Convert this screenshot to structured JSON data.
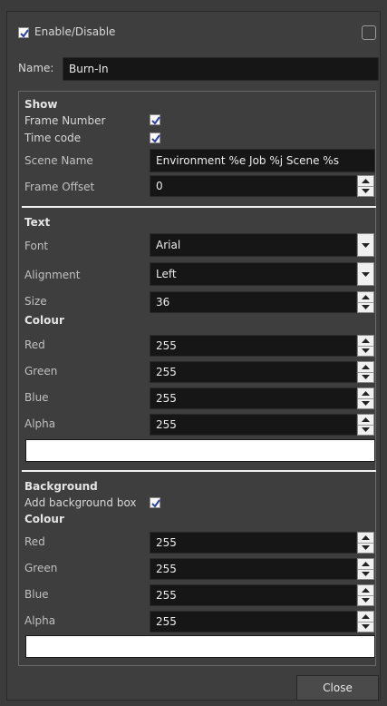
{
  "header": {
    "enable_label": "Enable/Disable",
    "name_label": "Name:",
    "name_value": "Burn-In"
  },
  "show": {
    "heading": "Show",
    "frame_number_label": "Frame Number",
    "time_code_label": "Time code",
    "scene_name_label": "Scene Name",
    "scene_name_value": "Environment %e Job %j Scene %s",
    "frame_offset_label": "Frame Offset",
    "frame_offset_value": "0"
  },
  "text": {
    "heading": "Text",
    "font_label": "Font",
    "font_value": "Arial",
    "alignment_label": "Alignment",
    "alignment_value": "Left",
    "size_label": "Size",
    "size_value": "36",
    "colour_heading": "Colour",
    "red_label": "Red",
    "red_value": "255",
    "green_label": "Green",
    "green_value": "255",
    "blue_label": "Blue",
    "blue_value": "255",
    "alpha_label": "Alpha",
    "alpha_value": "255"
  },
  "background": {
    "heading": "Background",
    "add_box_label": "Add background box",
    "colour_heading": "Colour",
    "red_label": "Red",
    "red_value": "255",
    "green_label": "Green",
    "green_value": "255",
    "blue_label": "Blue",
    "blue_value": "255",
    "alpha_label": "Alpha",
    "alpha_value": "255"
  },
  "footer": {
    "close_label": "Close"
  },
  "colors": {
    "window_bg": "#3e3e3e",
    "field_bg": "#161616",
    "checkbox_check": "#2b3f9e",
    "swatch_color": "#ffffff"
  },
  "icons": {
    "checkbox": "check-icon",
    "spin_up": "arrow-up-icon",
    "spin_down": "arrow-down-icon",
    "dropdown": "chevron-down-icon"
  }
}
